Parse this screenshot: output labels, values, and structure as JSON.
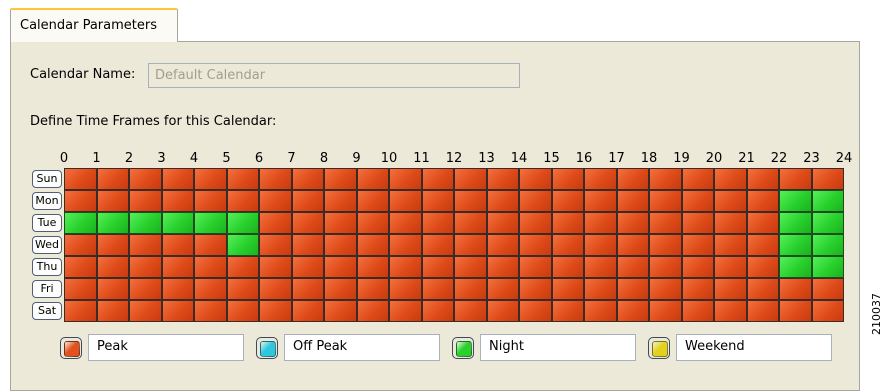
{
  "tab": {
    "label": "Calendar Parameters"
  },
  "calendar_name": {
    "label": "Calendar Name:",
    "value": "Default Calendar"
  },
  "time_frames_label": "Define Time Frames for this Calendar:",
  "hours": [
    "0",
    "1",
    "2",
    "3",
    "4",
    "5",
    "6",
    "7",
    "8",
    "9",
    "10",
    "11",
    "12",
    "13",
    "14",
    "15",
    "16",
    "17",
    "18",
    "19",
    "20",
    "21",
    "22",
    "23",
    "24"
  ],
  "days": [
    "Sun",
    "Mon",
    "Tue",
    "Wed",
    "Thu",
    "Fri",
    "Sat"
  ],
  "schedule": [
    "PPPPPPPPPPPPPPPPPPPPPPPP",
    "PPPPPPPPPPPPPPPPPPPPPPNN",
    "NNNNNNPPPPPPPPPPPPPPPPNN",
    "PPPPPNPPPPPPPPPPPPPPPPNN",
    "PPPPPPPPPPPPPPPPPPPPPPNN",
    "PPPPPPPPPPPPPPPPPPPPPPPP",
    "PPPPPPPPPPPPPPPPPPPPPPPP"
  ],
  "legend": [
    {
      "label": "Peak",
      "color": "#e2521f"
    },
    {
      "label": "Off Peak",
      "color": "#2fc6e0"
    },
    {
      "label": "Night",
      "color": "#2ad12e"
    },
    {
      "label": "Weekend",
      "color": "#e2d21c"
    }
  ],
  "figure_id": "210037"
}
